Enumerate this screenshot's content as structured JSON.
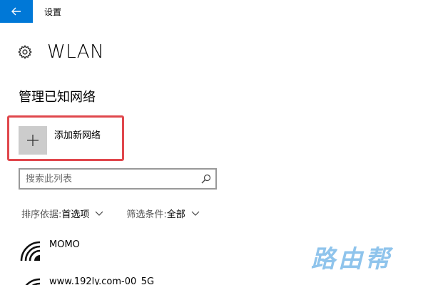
{
  "window": {
    "title": "设置",
    "accent_color": "#0078d7"
  },
  "header": {
    "title": "WLAN",
    "icon": "gear-icon"
  },
  "section": {
    "title": "管理已知网络"
  },
  "add_network": {
    "label": "添加新网络",
    "icon": "plus-icon",
    "highlight_color": "#e0474c"
  },
  "search": {
    "placeholder": "搜索此列表",
    "value": "",
    "icon": "search-icon"
  },
  "sort": {
    "label": "排序依据:",
    "value": "首选项"
  },
  "filter": {
    "label": "筛选条件:",
    "value": "全部"
  },
  "networks": [
    {
      "name": "MOMO",
      "icon": "wifi-icon"
    },
    {
      "name": "www.192ly.com-00_5G",
      "icon": "wifi-icon"
    }
  ],
  "watermark": {
    "text": "路由帮",
    "color": "#8fc4ec"
  }
}
